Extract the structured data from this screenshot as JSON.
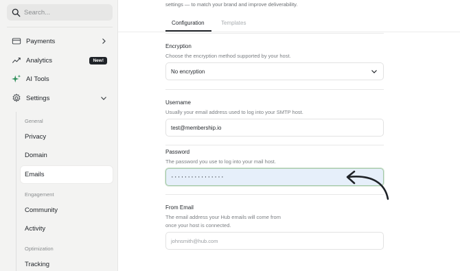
{
  "sidebar": {
    "search": {
      "placeholder": "Search..."
    },
    "nav": [
      {
        "label": "Payments",
        "icon": "credit-card-icon",
        "trail": "chevron-right-icon"
      },
      {
        "label": "Analytics",
        "icon": "chart-icon",
        "badge": "New!"
      },
      {
        "label": "AI Tools",
        "icon": "sparkles-icon"
      },
      {
        "label": "Settings",
        "icon": "gear-icon",
        "trail": "chevron-down-icon"
      }
    ],
    "groups": [
      {
        "label": "General",
        "items": [
          "Privacy",
          "Domain",
          "Emails"
        ]
      },
      {
        "label": "Engagement",
        "items": [
          "Community",
          "Activity"
        ]
      },
      {
        "label": "Optimization",
        "items": [
          "Tracking"
        ]
      }
    ],
    "active_item": "Emails"
  },
  "main": {
    "intro": "settings — to match your brand and improve deliverability.",
    "tabs": [
      {
        "label": "Configuration",
        "active": true
      },
      {
        "label": "Templates",
        "active": false
      }
    ],
    "fields": {
      "encryption": {
        "label": "Encryption",
        "help": "Choose the encryption method supported by your host.",
        "value": "No encryption"
      },
      "username": {
        "label": "Username",
        "help": "Usually your email address used to log into your SMTP host.",
        "value": "test@membership.io"
      },
      "password": {
        "label": "Password",
        "help": "The password you use to log into your mail host.",
        "value": "················"
      },
      "from_email": {
        "label": "From Email",
        "help_line1": "The email address your Hub emails will come from",
        "help_line2": "once your host is connected.",
        "placeholder": "johnsmith@hub.com"
      }
    }
  },
  "colors": {
    "sidebar_bg": "#f3f3f2",
    "focus_fill": "#e6effa",
    "focus_border": "#a3c8a6",
    "accent_dark": "#1f2328"
  }
}
